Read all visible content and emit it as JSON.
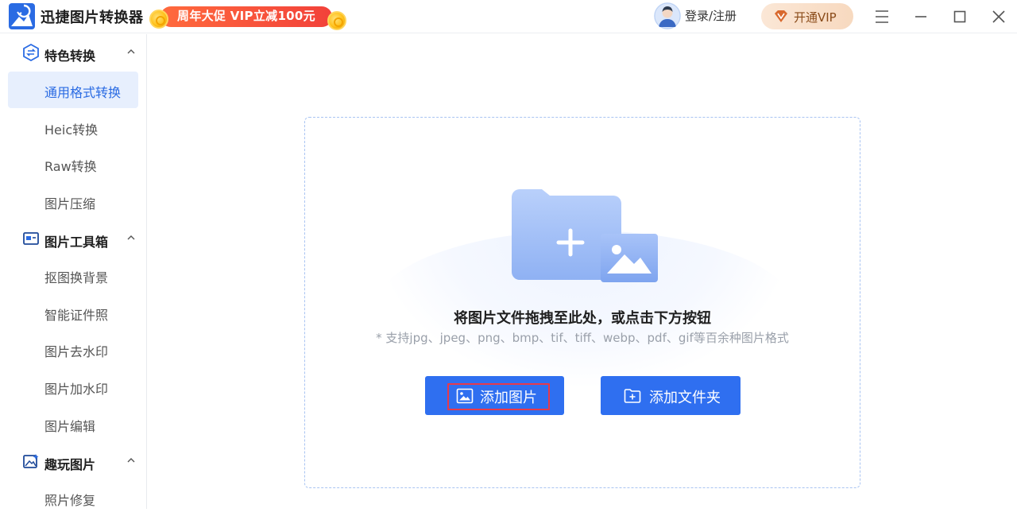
{
  "app": {
    "name": "迅捷图片转换器"
  },
  "promo": {
    "text": "周年大促 VIP立减100元"
  },
  "header": {
    "login_label": "登录/注册",
    "vip_label": "开通VIP"
  },
  "window_controls": [
    "menu-icon",
    "minimize-icon",
    "maximize-icon",
    "close-icon"
  ],
  "sidebar": {
    "groups": [
      {
        "label": "特色转换",
        "icon": "convert-icon",
        "items": [
          {
            "label": "通用格式转换",
            "active": true
          },
          {
            "label": "Heic转换"
          },
          {
            "label": "Raw转换"
          },
          {
            "label": "图片压缩"
          }
        ]
      },
      {
        "label": "图片工具箱",
        "icon": "toolbox-icon",
        "items": [
          {
            "label": "抠图换背景"
          },
          {
            "label": "智能证件照"
          },
          {
            "label": "图片去水印"
          },
          {
            "label": "图片加水印"
          },
          {
            "label": "图片编辑"
          }
        ]
      },
      {
        "label": "趣玩图片",
        "icon": "image-fun-icon",
        "items": [
          {
            "label": "照片修复"
          }
        ]
      }
    ]
  },
  "dropzone": {
    "title": "将图片文件拖拽至此处，或点击下方按钮",
    "subtitle": "* 支持jpg、jpeg、png、bmp、tif、tiff、webp、pdf、gif等百余种图片格式",
    "add_image_label": "添加图片",
    "add_folder_label": "添加文件夹"
  },
  "colors": {
    "accent": "#2f6ff0",
    "active_bg": "#e7effd",
    "active_text": "#2a6be3",
    "promo": "#f2413a",
    "focus_ring": "#e8394a"
  }
}
